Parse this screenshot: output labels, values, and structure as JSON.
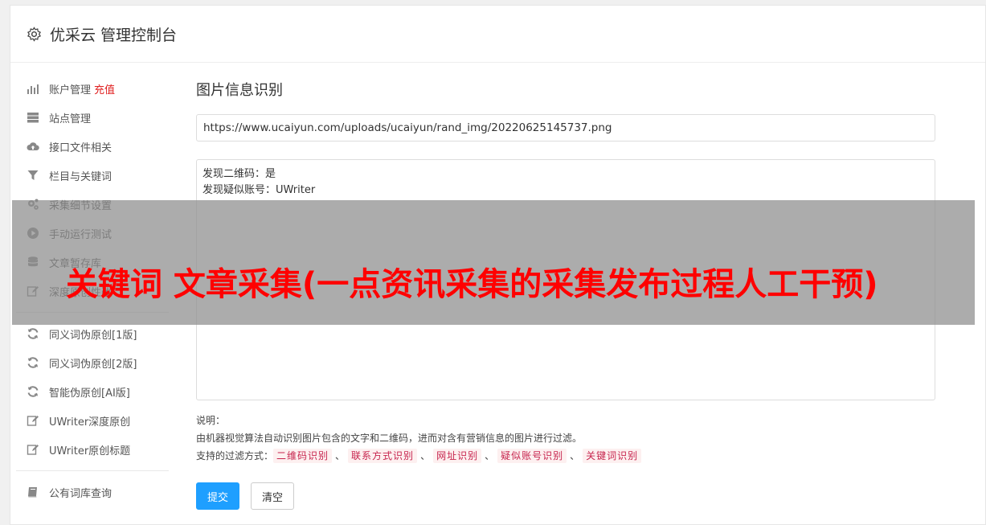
{
  "header": {
    "title": "优采云 管理控制台",
    "icon": "gear-icon"
  },
  "sidebar": {
    "group1": [
      {
        "label": "账户管理",
        "tag": "充值",
        "icon": "bar-chart-icon"
      },
      {
        "label": "站点管理",
        "icon": "server-icon"
      },
      {
        "label": "接口文件相关",
        "icon": "cloud-upload-icon"
      },
      {
        "label": "栏目与关键词",
        "icon": "filter-icon"
      },
      {
        "label": "采集细节设置",
        "icon": "gears-icon"
      },
      {
        "label": "手动运行测试",
        "icon": "play-circle-icon"
      },
      {
        "label": "文章暂存库",
        "icon": "database-icon"
      },
      {
        "label": "深度原创性改",
        "icon": "edit-icon"
      }
    ],
    "group2": [
      {
        "label": "同义词伪原创[1版]",
        "icon": "refresh-icon"
      },
      {
        "label": "同义词伪原创[2版]",
        "icon": "refresh-icon"
      },
      {
        "label": "智能伪原创[AI版]",
        "icon": "refresh-icon"
      },
      {
        "label": "UWriter深度原创",
        "icon": "edit-icon"
      },
      {
        "label": "UWriter原创标题",
        "icon": "edit-icon"
      }
    ],
    "group3": [
      {
        "label": "公有词库查询",
        "icon": "book-icon"
      }
    ]
  },
  "main": {
    "title": "图片信息识别",
    "url_value": "https://www.ucaiyun.com/uploads/ucaiyun/rand_img/20220625145737.png",
    "result_lines": [
      "发现二维码：是",
      "发现疑似账号：UWriter"
    ],
    "desc_label": "说明：",
    "desc_text": "由机器视觉算法自动识别图片包含的文字和二维码，进而对含有营销信息的图片进行过滤。",
    "filter_label": "支持的过滤方式：",
    "filters": [
      "二维码识别",
      "联系方式识别",
      "网址识别",
      "疑似账号识别",
      "关键词识别"
    ],
    "filter_sep": "、",
    "submit_label": "提交",
    "clear_label": "清空"
  },
  "overlay": {
    "text": "关键词 文章采集(一点资讯采集的采集发布过程人工干预)"
  },
  "colors": {
    "primary": "#1e9fff",
    "tag_red": "#e02020",
    "overlay_text": "#ff0000",
    "chip_text": "#c7254e"
  }
}
